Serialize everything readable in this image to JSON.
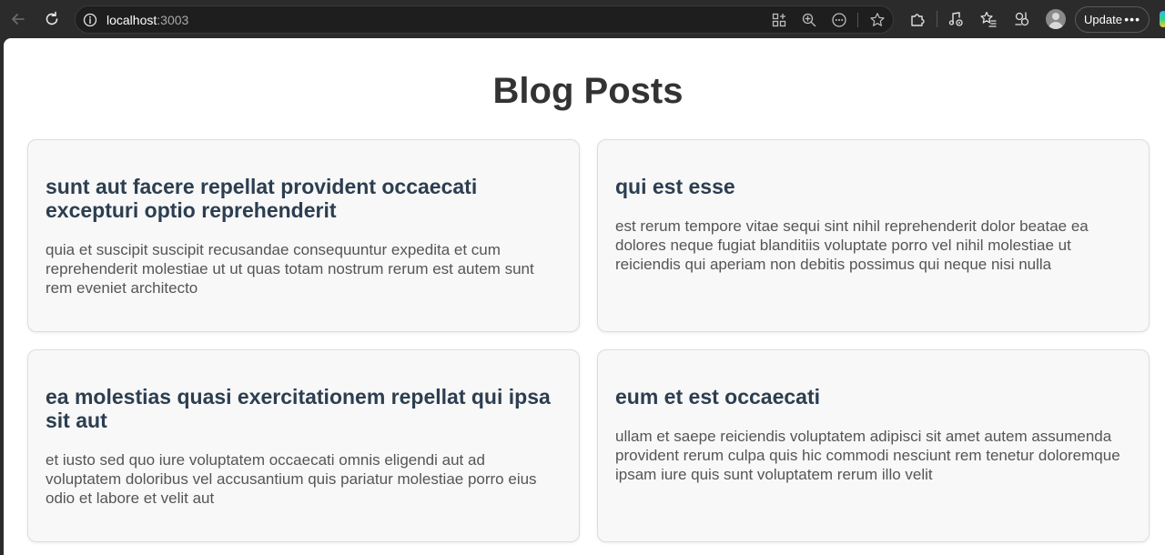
{
  "browser": {
    "url_host": "localhost",
    "url_port": ":3003",
    "update_label": "Update"
  },
  "page": {
    "title": "Blog Posts"
  },
  "posts": [
    {
      "title": "sunt aut facere repellat provident occaecati excepturi optio reprehenderit",
      "body": "quia et suscipit suscipit recusandae consequuntur expedita et cum reprehenderit molestiae ut ut quas totam nostrum rerum est autem sunt rem eveniet architecto"
    },
    {
      "title": "qui est esse",
      "body": "est rerum tempore vitae sequi sint nihil reprehenderit dolor beatae ea dolores neque fugiat blanditiis voluptate porro vel nihil molestiae ut reiciendis qui aperiam non debitis possimus qui neque nisi nulla"
    },
    {
      "title": "ea molestias quasi exercitationem repellat qui ipsa sit aut",
      "body": "et iusto sed quo iure voluptatem occaecati omnis eligendi aut ad voluptatem doloribus vel accusantium quis pariatur molestiae porro eius odio et labore et velit aut"
    },
    {
      "title": "eum et est occaecati",
      "body": "ullam et saepe reiciendis voluptatem adipisci sit amet autem assumenda provident rerum culpa quis hic commodi nesciunt rem tenetur doloremque ipsam iure quis sunt voluptatem rerum illo velit"
    }
  ]
}
